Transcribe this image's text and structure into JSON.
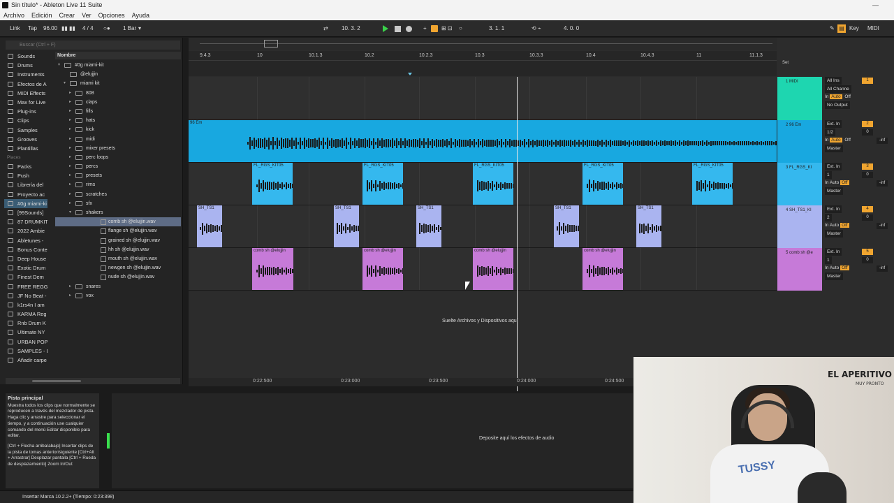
{
  "window": {
    "title": "Sin título* - Ableton Live 11 Suite",
    "minimize": "—"
  },
  "menu": [
    "Archivo",
    "Edición",
    "Crear",
    "Ver",
    "Opciones",
    "Ayuda"
  ],
  "control_bar": {
    "link": "Link",
    "tap": "Tap",
    "tempo": "96.00",
    "signature": "4 / 4",
    "quantize": "1 Bar",
    "arr_position": "10.  3.  2",
    "loop_start": "3.  1.  1",
    "loop_length": "4.  0.  0",
    "key": "Key",
    "midi": "MIDI"
  },
  "browser": {
    "search_placeholder": "Buscar (Ctrl + F)",
    "categories": [
      "Sounds",
      "Drums",
      "Instruments",
      "Efectos de A",
      "MIDI Effects",
      "Max for Live",
      "Plug-ins",
      "Clips",
      "Samples",
      "Grooves",
      "Plantillas"
    ],
    "places_label": "Places",
    "places": [
      "Packs",
      "Push",
      "Librería del",
      "Proyecto ac",
      "#0g miami-ki",
      "[99Sounds]",
      "87 DRUMKIT",
      "2022 Ambie",
      "Abletunes -",
      "Bonus Conte",
      "Deep House",
      "Exotic Drum",
      "Finest Dem",
      "FREE REGGA",
      "JF No Beat -",
      "k1rs4n I am",
      "KARMA Reg",
      "Rnb Drum K",
      "Ultimate NY",
      "URBAN POP",
      "SAMPLES - E",
      "Añadir carpe"
    ],
    "name_header": "Nombre",
    "tree": [
      {
        "label": "#0g miami-kit",
        "type": "folder",
        "depth": 0,
        "arrow": "▾"
      },
      {
        "label": "@elujjin",
        "type": "folder",
        "depth": 1,
        "arrow": ""
      },
      {
        "label": "miami kit",
        "type": "folder",
        "depth": 1,
        "arrow": "▾"
      },
      {
        "label": "808",
        "type": "folder",
        "depth": 2,
        "arrow": "▸"
      },
      {
        "label": "claps",
        "type": "folder",
        "depth": 2,
        "arrow": "▸"
      },
      {
        "label": "fills",
        "type": "folder",
        "depth": 2,
        "arrow": "▸"
      },
      {
        "label": "hats",
        "type": "folder",
        "depth": 2,
        "arrow": "▸"
      },
      {
        "label": "kick",
        "type": "folder",
        "depth": 2,
        "arrow": "▸"
      },
      {
        "label": "midi",
        "type": "folder",
        "depth": 2,
        "arrow": "▸"
      },
      {
        "label": "mixer presets",
        "type": "folder",
        "depth": 2,
        "arrow": "▸"
      },
      {
        "label": "perc loops",
        "type": "folder",
        "depth": 2,
        "arrow": "▸"
      },
      {
        "label": "percs",
        "type": "folder",
        "depth": 2,
        "arrow": "▸"
      },
      {
        "label": "presets",
        "type": "folder",
        "depth": 2,
        "arrow": "▸"
      },
      {
        "label": "rims",
        "type": "folder",
        "depth": 2,
        "arrow": "▸"
      },
      {
        "label": "scratches",
        "type": "folder",
        "depth": 2,
        "arrow": "▸"
      },
      {
        "label": "sfx",
        "type": "folder",
        "depth": 2,
        "arrow": "▸"
      },
      {
        "label": "shakers",
        "type": "folder",
        "depth": 2,
        "arrow": "▾"
      },
      {
        "label": "comb sh @elujjin.wav",
        "type": "file",
        "depth": 3,
        "arrow": "",
        "selected": true
      },
      {
        "label": "flange sh @elujjin.wav",
        "type": "file",
        "depth": 3,
        "arrow": ""
      },
      {
        "label": "grained sh @elujjin.wav",
        "type": "file",
        "depth": 3,
        "arrow": ""
      },
      {
        "label": "hh sh @elujjin.wav",
        "type": "file",
        "depth": 3,
        "arrow": ""
      },
      {
        "label": "mouth sh @elujjin.wav",
        "type": "file",
        "depth": 3,
        "arrow": ""
      },
      {
        "label": "newgen sh @elujjin.wav",
        "type": "file",
        "depth": 3,
        "arrow": ""
      },
      {
        "label": "nude sh @elujjin.wav",
        "type": "file",
        "depth": 3,
        "arrow": ""
      },
      {
        "label": "snares",
        "type": "folder",
        "depth": 2,
        "arrow": "▸"
      },
      {
        "label": "vox",
        "type": "folder",
        "depth": 2,
        "arrow": "▸"
      }
    ]
  },
  "arrangement": {
    "ruler": [
      "9.4.3",
      "10",
      "10.1.3",
      "10.2",
      "10.2.3",
      "10.3",
      "10.3.3",
      "10.4",
      "10.4.3",
      "11",
      "11.1.3"
    ],
    "set_label": "Set",
    "time_ruler": [
      "0:22:500",
      "0:23:000",
      "0:23:500",
      "0:24:000",
      "0:24:500"
    ],
    "drop_text": "Suelte Archivos y Dispositivos aquí",
    "tracks": [
      {
        "name": "1 MIDI",
        "color": "#1ed6b0",
        "height": 62,
        "clips": [],
        "input": "All Ins",
        "channel": "All Channe",
        "mode": "No Output",
        "number": "1",
        "volume": "",
        "inf": ""
      },
      {
        "name": "2 96 Em",
        "color": "#18a8e0",
        "height": 61,
        "clip_label": "96 Em",
        "clips": [
          {
            "s": 0,
            "e": 842
          }
        ],
        "input": "Ext. In",
        "channel": "1/2",
        "mode": "Master",
        "number": "2",
        "volume": "0",
        "inf": "-inf"
      },
      {
        "name": "3 FL_RGS_KI",
        "color": "#35b8ee",
        "height": 61,
        "clip_label": "FL_RGS_KIT05",
        "clips": [
          {
            "s": 91,
            "e": 149
          },
          {
            "s": 249,
            "e": 307
          },
          {
            "s": 407,
            "e": 465
          },
          {
            "s": 564,
            "e": 622
          },
          {
            "s": 721,
            "e": 779
          }
        ],
        "input": "Ext. In",
        "channel": "1",
        "mode": "Master",
        "number": "3",
        "volume": "0",
        "inf": "-inf"
      },
      {
        "name": "4 SH_TS1_KI",
        "color": "#aab4f0",
        "height": 61,
        "clip_label": "SH_TS1",
        "clips": [
          {
            "s": 12,
            "e": 48
          },
          {
            "s": 208,
            "e": 244
          },
          {
            "s": 326,
            "e": 362
          },
          {
            "s": 523,
            "e": 559
          },
          {
            "s": 641,
            "e": 677
          }
        ],
        "input": "Ext. In",
        "channel": "2",
        "mode": "Master",
        "number": "4",
        "volume": "0",
        "inf": "-inf"
      },
      {
        "name": "5 comb sh @e",
        "color": "#c67ad8",
        "height": 61,
        "clip_label": "comb sh @elujjin",
        "clips": [
          {
            "s": 91,
            "e": 150
          },
          {
            "s": 249,
            "e": 307
          },
          {
            "s": 407,
            "e": 465
          },
          {
            "s": 564,
            "e": 622
          }
        ],
        "input": "Ext. In",
        "channel": "1",
        "mode": "Master",
        "number": "5",
        "volume": "0",
        "inf": "-inf"
      }
    ],
    "io_in": "In",
    "io_auto": "Auto",
    "io_off": "Off"
  },
  "bottom": {
    "info_title": "Pista principal",
    "info_p1": "Muestra todos los clips que normalmente se reproducen a través del mezclador de pista. Haga clic y arrastre para seleccionar el tiempo, y a continuación use cualquier comando del menú Editar disponible para editar.",
    "info_p2": "[Ctrl + Flecha arriba/abajo] Insertar clips de la pista de tomas anterior/siguiente [Ctrl+Alt + Arrastrar] Desplazar pantalla [Ctrl + Rueda de desplazamiento] Zoom In/Out",
    "device_text": "Deposite aquí los efectos de audio",
    "status": "Insertar Marca 10.2.2+ (Tiempo: 0:23:398)"
  },
  "webcam": {
    "poster": "EL APERITIVO",
    "poster_sub": "MUY PRONTO",
    "shirt_text": "TUSSY"
  }
}
